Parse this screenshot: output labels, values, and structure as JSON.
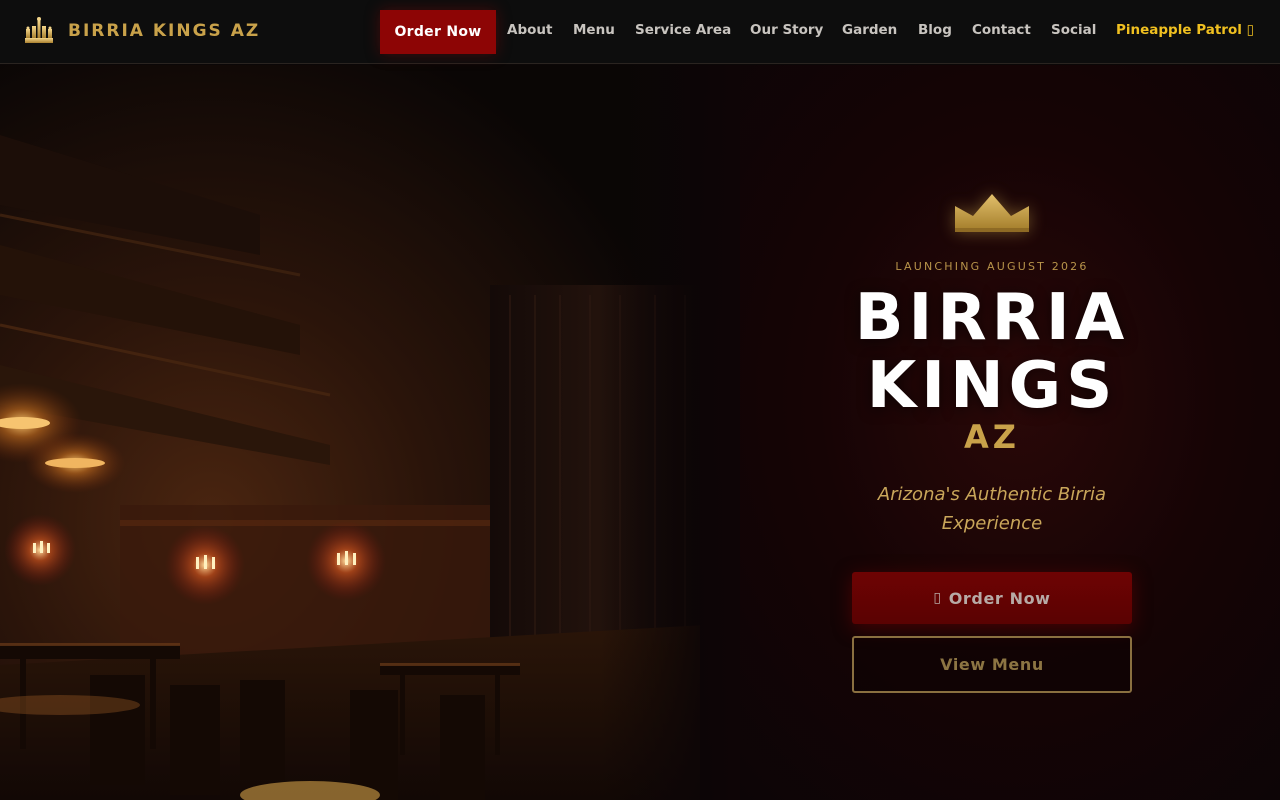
{
  "nav": {
    "brand_name": "BIRRIA KINGS AZ",
    "order_label": "Order Now",
    "links": [
      "About",
      "Menu",
      "Service Area",
      "Our Story",
      "Garden",
      "Blog",
      "Contact",
      "Social"
    ],
    "patrol_label": "Pineapple Patrol ▯"
  },
  "hero": {
    "eyebrow": "LAUNCHING AUGUST 2026",
    "title_line1": "BIRRIA",
    "title_line2": "KINGS",
    "title_suffix": "AZ",
    "tagline": "Arizona's Authentic Birria Experience",
    "primary_icon": "▯",
    "primary_label": "Order Now",
    "secondary_label": "View Menu",
    "crown_icon": "crown-icon",
    "background_image": "dark restaurant interior with wall sconces"
  },
  "colors": {
    "accent_gold": "#c9a24a",
    "accent_red": "#8d0505",
    "patrol_yellow": "#f0c020",
    "nav_bg": "#0d0d0d"
  }
}
